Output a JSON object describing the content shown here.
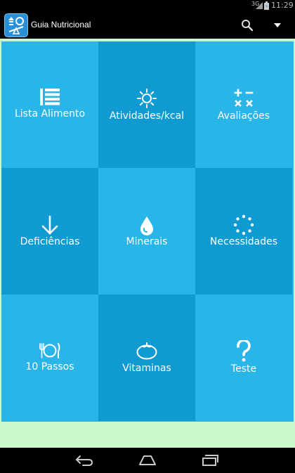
{
  "status_bar": {
    "network": "3G",
    "time": "11:29"
  },
  "action_bar": {
    "title": "Guia Nutricional",
    "search_icon": "search-icon",
    "overflow_icon": "chevron-down-icon"
  },
  "tiles": [
    {
      "label": "Lista Alimento",
      "icon": "list-icon"
    },
    {
      "label": "Atividades/kcal",
      "icon": "sun-icon"
    },
    {
      "label": "Avaliações",
      "icon": "calculator-icon"
    },
    {
      "label": "Deficiências",
      "icon": "arrow-down-icon"
    },
    {
      "label": "Minerais",
      "icon": "water-drop-icon"
    },
    {
      "label": "Necessidades",
      "icon": "dotted-circle-icon"
    },
    {
      "label": "10 Passos",
      "icon": "cutlery-icon"
    },
    {
      "label": "Vitaminas",
      "icon": "tomato-icon"
    },
    {
      "label": "Teste",
      "icon": "question-icon"
    }
  ],
  "colors": {
    "tile_light": "#29b5e8",
    "tile_dark": "#0f9bd2",
    "background": "#c9fbca"
  },
  "nav_bar": {
    "back_icon": "back-icon",
    "home_icon": "home-icon",
    "recents_icon": "recents-icon"
  }
}
